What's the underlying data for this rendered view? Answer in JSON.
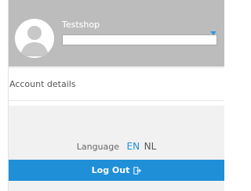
{
  "user": {
    "shop_name": "Testshop",
    "shop_select_value": ""
  },
  "menu": {
    "account_details_label": "Account details"
  },
  "language": {
    "label": "Language",
    "options": [
      "EN",
      "NL"
    ],
    "selected": "EN"
  },
  "logout": {
    "label": "Log Out",
    "icon": "logout-icon"
  },
  "colors": {
    "header_bg": "#bcbcbc",
    "accent": "#1f8fd8",
    "footer_bg": "#f1f1f1"
  }
}
